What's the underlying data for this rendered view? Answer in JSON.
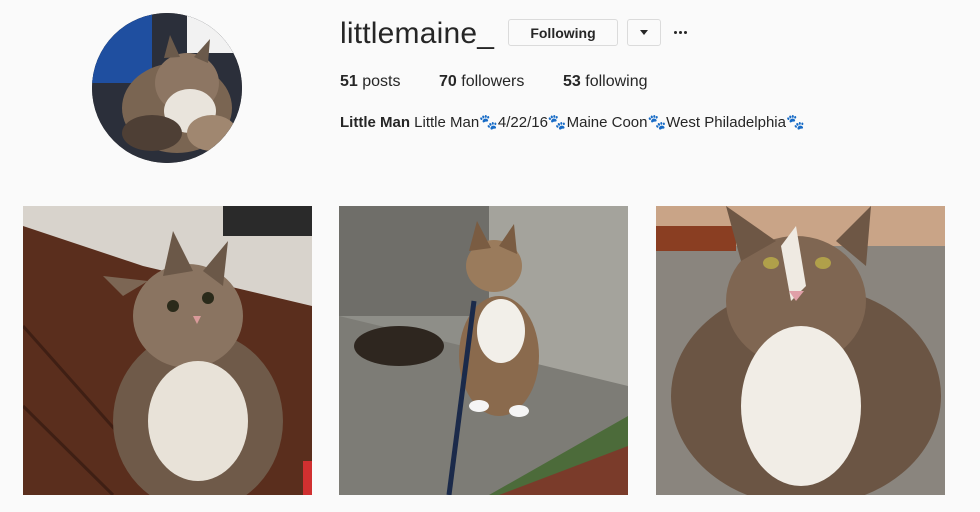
{
  "profile": {
    "username": "littlemaine_",
    "following_label": "Following",
    "stats": {
      "posts_count": "51",
      "posts_label": "posts",
      "followers_count": "70",
      "followers_label": "followers",
      "following_count": "53",
      "following_label": "following"
    },
    "bio": {
      "full_name": "Little Man",
      "text": "Little Man🐾4/22/16🐾Maine Coon🐾West Philadelphia🐾"
    }
  },
  "posts": [
    {
      "subject": "tabby maine coon cat looking up on wooden floor"
    },
    {
      "subject": "maine coon cat on leash sitting outdoors"
    },
    {
      "subject": "maine coon cat close-up on woven mat"
    }
  ],
  "colors": {
    "background": "#fafafa",
    "text": "#262626",
    "border": "#dbdbdb"
  }
}
